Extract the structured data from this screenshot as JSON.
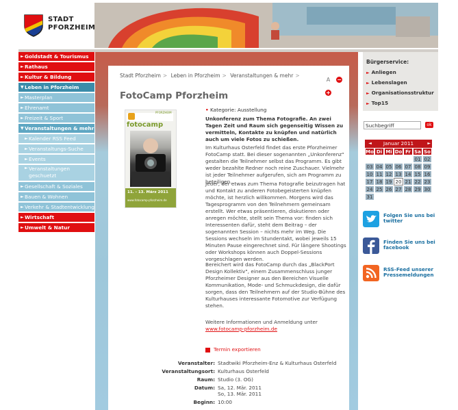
{
  "logo": {
    "line1": "STADT",
    "line2": "PFORZHEIM"
  },
  "nav": [
    {
      "label": "Goldstadt & Tourismus",
      "style": "red"
    },
    {
      "label": "Rathaus",
      "style": "red"
    },
    {
      "label": "Kultur & Bildung",
      "style": "red"
    },
    {
      "label": "Leben in Pforzheim",
      "style": "blue"
    },
    {
      "label": "Masterplan",
      "style": "light"
    },
    {
      "label": "Ehrenamt",
      "style": "light"
    },
    {
      "label": "Freizeit & Sport",
      "style": "light"
    },
    {
      "label": "Veranstaltungen & mehr",
      "style": "active"
    },
    {
      "label": "Kalender RSS Feed",
      "style": "sub"
    },
    {
      "label": "Veranstaltungs-Suche",
      "style": "sub"
    },
    {
      "label": "Events",
      "style": "sub"
    },
    {
      "label": "Veranstaltungen geschuetzt",
      "style": "sub"
    },
    {
      "label": "Gesellschaft & Soziales",
      "style": "light"
    },
    {
      "label": "Bauen & Wohnen",
      "style": "light"
    },
    {
      "label": "Verkehr & Stadtentwicklung",
      "style": "light"
    },
    {
      "label": "Wirtschaft",
      "style": "red"
    },
    {
      "label": "Umwelt & Natur",
      "style": "red"
    }
  ],
  "breadcrumb": [
    "Stadt Pforzheim",
    "Leben in Pforzheim",
    "Veranstaltungen & mehr"
  ],
  "title": "FotoCamp Pforzheim",
  "poster": {
    "brand": "fotocamp",
    "tag": "PFORZHEIM",
    "date": "11. - 13. März 2011",
    "url": "www.fotocamp-pforzheim.de"
  },
  "article": {
    "kategorie": "Kategorie: Ausstellung",
    "lead": "Unkonferenz zum Thema Fotografie. An zwei Tagen Zeit und Raum sich gegenseitig Wissen zu vermitteln, Kontakte zu knüpfen und natürlich auch um viele Fotos zu schießen.",
    "p1": "Im Kulturhaus Osterfeld findet das erste Pforzheimer FotoCamp statt. Bei dieser sogenannten „Unkonferenz\" gestalten die Teilnehmer selbst das Programm. Es gibt weder bezahlte Redner noch reine Zuschauer. Vielmehr ist jeder Teilnehmer aufgerufen, sich am Programm zu beteiligen.",
    "p2": "Jeder, der etwas zum Thema Fotografie beizutragen hat und Kontakt zu anderen Fotobegeisterten knüpfen möchte, ist herzlich willkommen. Morgens wird das Tagesprogramm von den Teilnehmern gemeinsam erstellt. Wer etwas präsentieren, diskutieren oder anregen möchte, stellt sein Thema vor: finden sich Interessenten dafür, steht dem Beitrag – der sogenannten Session – nichts mehr im Weg. Die Sessions wechseln im Stundentakt, wobei jeweils 15 Minuten Pause eingerechnet sind. Für längere Shootings oder Workshops können auch Doppel-Sessions vorgeschlagen werden.",
    "p3": "Bereichert wird das FotoCamp durch das „BlackPort Design Kollektiv\", einem Zusammenschluss junger Pforzheimer Designer aus den Bereichen Visuelle Kommunikation, Mode- und Schmuckdesign, die dafür sorgen, dass den Teilnehmern auf der Studio-Bühne des Kulturhauses interessante Fotomotive zur Verfügung stehen.",
    "p4": "Weitere Informationen und Anmeldung unter",
    "link": "www.fotocamp-pforzheim.de",
    "termin": "Termin exportieren"
  },
  "details": [
    {
      "label": "Veranstalter:",
      "value": "Stadtwiki Pforzheim-Enz & Kulturhaus Osterfeld"
    },
    {
      "label": "Veranstaltungsort:",
      "value": "Kulturhaus Osterfeld"
    },
    {
      "label": "Raum:",
      "value": "Studio (3. OG)"
    },
    {
      "label": "Datum:",
      "value": "Sa, 12. Mär. 2011"
    },
    {
      "label": "",
      "value": "So, 13. Mär. 2011"
    },
    {
      "label": "Beginn:",
      "value": "10:00"
    }
  ],
  "buergerservice": {
    "title": "Bürgerservice:",
    "items": [
      "Anliegen",
      "Lebenslagen",
      "Organisationsstruktur",
      "Top15"
    ]
  },
  "search": {
    "value": "Suchbegriff",
    "button": "ok"
  },
  "calendar": {
    "month": "Januar 2011",
    "dow": [
      "Mo",
      "Di",
      "Mi",
      "Do",
      "Fr",
      "Sa",
      "So"
    ],
    "weeks": [
      [
        "",
        "",
        "",
        "",
        "",
        "01",
        "02"
      ],
      [
        "03",
        "04",
        "05",
        "06",
        "07",
        "08",
        "09"
      ],
      [
        "10",
        "11",
        "12",
        "13",
        "14",
        "15",
        "16"
      ],
      [
        "17",
        "18",
        "19",
        "20",
        "21",
        "22",
        "23"
      ],
      [
        "24",
        "25",
        "26",
        "27",
        "28",
        "29",
        "30"
      ],
      [
        "31",
        "",
        "",
        "",
        "",
        "",
        ""
      ]
    ],
    "today": "20"
  },
  "social": [
    {
      "label": "Folgen Sie uns bei twitter",
      "icon": "twitter-icon",
      "color": "#1da1e2"
    },
    {
      "label": "Finden Sie uns bei facebook",
      "icon": "facebook-icon",
      "color": "#3b5998"
    },
    {
      "label": "RSS-Feed unserer Pressemeldungen",
      "icon": "rss-icon",
      "color": "#f26522"
    }
  ],
  "colors": {
    "accent_red": "#e00f11",
    "nav_blue": "#3b8caa",
    "nav_light": "#8fc3d8",
    "link_blue": "#1a6fa0"
  }
}
